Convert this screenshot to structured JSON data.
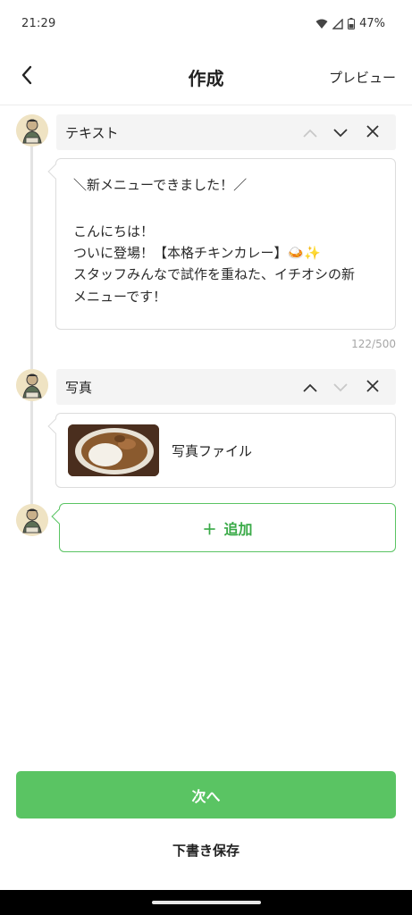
{
  "status_bar": {
    "time": "21:29",
    "battery": "47%"
  },
  "header": {
    "title": "作成",
    "preview_label": "プレビュー"
  },
  "blocks": [
    {
      "title": "テキスト",
      "lines": [
        "＼新メニューできました！／",
        "",
        "こんにちは！",
        "ついに登場！【本格チキンカレー】🍛✨",
        "スタッフみんなで試作を重ねた、イチオシの新",
        "メニューです！"
      ],
      "counter": "122/500"
    },
    {
      "title": "写真",
      "photo_label": "写真ファイル"
    }
  ],
  "add_button": {
    "icon": "＋",
    "label": "追加"
  },
  "footer": {
    "next_label": "次へ",
    "draft_label": "下書き保存"
  },
  "colors": {
    "accent": "#5ac463",
    "header_bg": "#f4f4f4",
    "border": "#dcdcdc"
  }
}
